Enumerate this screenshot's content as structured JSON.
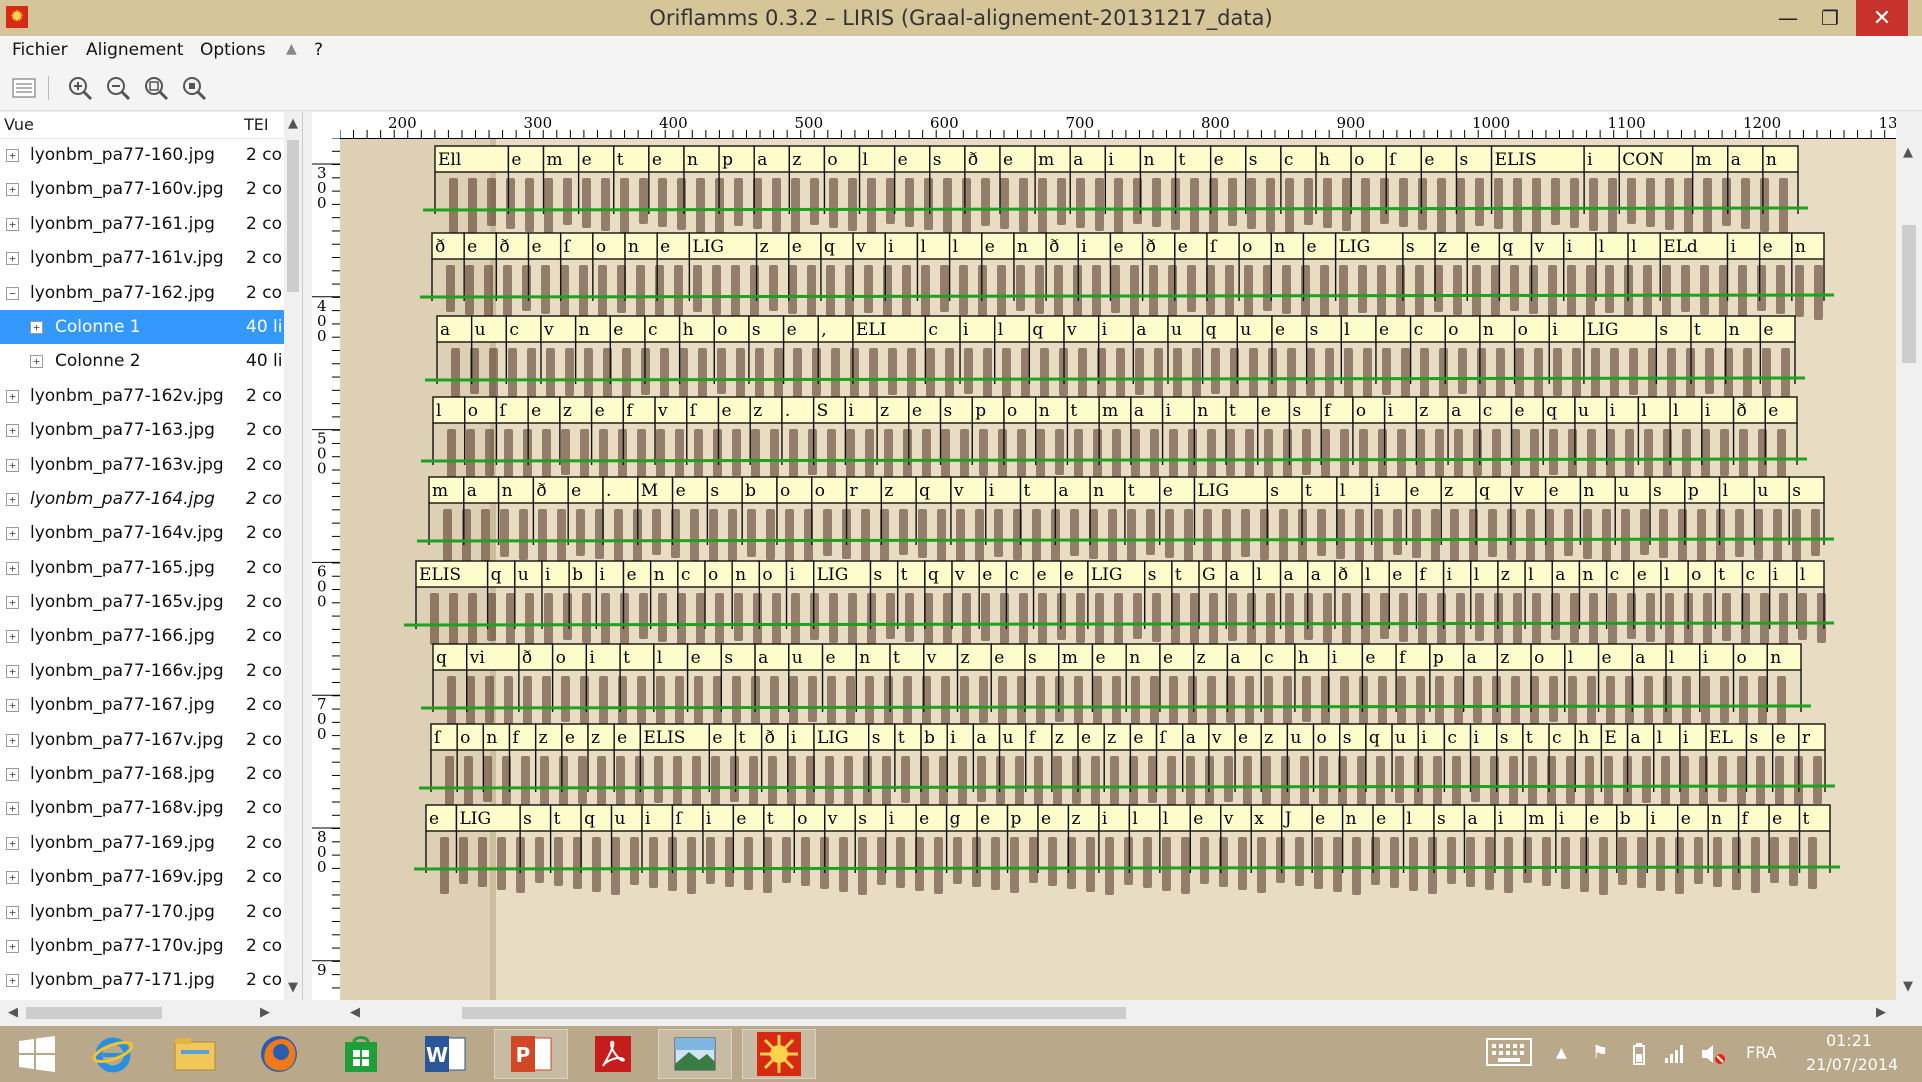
{
  "window": {
    "title": "Oriflamms 0.3.2 – LIRIS (Graal-alignement-20131217_data)",
    "controls": {
      "minimize": "—",
      "maximize": "❐",
      "close": "✕"
    }
  },
  "menu": {
    "items": [
      "Fichier",
      "Alignement",
      "Options",
      "?"
    ]
  },
  "toolbar": {
    "icons": [
      "panel-toggle-icon",
      "zoom-in-icon",
      "zoom-out-icon",
      "zoom-fit-icon",
      "zoom-reset-icon"
    ]
  },
  "tree": {
    "col_vue": "Vue",
    "col_tei": "TEI",
    "rows": [
      {
        "name": "lyonbm_pa77-160.jpg",
        "value": "2 co",
        "level": 0,
        "expander": "+"
      },
      {
        "name": "lyonbm_pa77-160v.jpg",
        "value": "2 co",
        "level": 0,
        "expander": "+"
      },
      {
        "name": "lyonbm_pa77-161.jpg",
        "value": "2 co",
        "level": 0,
        "expander": "+"
      },
      {
        "name": "lyonbm_pa77-161v.jpg",
        "value": "2 co",
        "level": 0,
        "expander": "+"
      },
      {
        "name": "lyonbm_pa77-162.jpg",
        "value": "2 co",
        "level": 0,
        "expander": "−"
      },
      {
        "name": "Colonne 1",
        "value": "40 li",
        "level": 1,
        "expander": "+",
        "selected": true
      },
      {
        "name": "Colonne 2",
        "value": "40 li",
        "level": 1,
        "expander": "+"
      },
      {
        "name": "lyonbm_pa77-162v.jpg",
        "value": "2 co",
        "level": 0,
        "expander": "+"
      },
      {
        "name": "lyonbm_pa77-163.jpg",
        "value": "2 co",
        "level": 0,
        "expander": "+"
      },
      {
        "name": "lyonbm_pa77-163v.jpg",
        "value": "2 co",
        "level": 0,
        "expander": "+"
      },
      {
        "name": "lyonbm_pa77-164.jpg",
        "value": "2 co",
        "level": 0,
        "expander": "+",
        "italic": true
      },
      {
        "name": "lyonbm_pa77-164v.jpg",
        "value": "2 co",
        "level": 0,
        "expander": "+"
      },
      {
        "name": "lyonbm_pa77-165.jpg",
        "value": "2 co",
        "level": 0,
        "expander": "+"
      },
      {
        "name": "lyonbm_pa77-165v.jpg",
        "value": "2 co",
        "level": 0,
        "expander": "+"
      },
      {
        "name": "lyonbm_pa77-166.jpg",
        "value": "2 co",
        "level": 0,
        "expander": "+"
      },
      {
        "name": "lyonbm_pa77-166v.jpg",
        "value": "2 co",
        "level": 0,
        "expander": "+"
      },
      {
        "name": "lyonbm_pa77-167.jpg",
        "value": "2 co",
        "level": 0,
        "expander": "+"
      },
      {
        "name": "lyonbm_pa77-167v.jpg",
        "value": "2 co",
        "level": 0,
        "expander": "+"
      },
      {
        "name": "lyonbm_pa77-168.jpg",
        "value": "2 co",
        "level": 0,
        "expander": "+"
      },
      {
        "name": "lyonbm_pa77-168v.jpg",
        "value": "2 co",
        "level": 0,
        "expander": "+"
      },
      {
        "name": "lyonbm_pa77-169.jpg",
        "value": "2 co",
        "level": 0,
        "expander": "+"
      },
      {
        "name": "lyonbm_pa77-169v.jpg",
        "value": "2 co",
        "level": 0,
        "expander": "+"
      },
      {
        "name": "lyonbm_pa77-170.jpg",
        "value": "2 co",
        "level": 0,
        "expander": "+"
      },
      {
        "name": "lyonbm_pa77-170v.jpg",
        "value": "2 co",
        "level": 0,
        "expander": "+"
      },
      {
        "name": "lyonbm_pa77-171.jpg",
        "value": "2 co",
        "level": 0,
        "expander": "+"
      }
    ]
  },
  "rulers": {
    "top_labels": [
      "200",
      "300",
      "400",
      "500",
      "600",
      "700",
      "800",
      "900",
      "1000",
      "1100",
      "1200",
      "13"
    ],
    "left_labels": [
      "300",
      "400",
      "500",
      "600",
      "700",
      "800",
      "9"
    ]
  },
  "canvas": {
    "lines": [
      "Ell e m e t e n p a z o l e s ð e m a i n t e s c h o ſ e s ELIS i CON m a n",
      "ð e ð e ſ o n e LIG z e q v i l l e n ð i e ð e ſ o n e LIG s z e q v i l l ELd i e n",
      "a u c v n e c h o s e , ELI c i l q v i a u q u e s l e c o n o i LIG s t n e",
      "l o ſ e z e f v ſ e z . S i z e s p o n t m a i n t e s f o i z a c e q u i l l i ð e",
      "m a n ð e . M e s b o o r z q v i t a n t e LIG s t l i e z q v e n u s p l u s",
      "ELIS q u i b i e n c o n o i LIG s t q v e c e e LIG s t G a l a a ð l e f i l z l a n c e l o t c i l",
      "q vi ð o i t l e s a u e n t v z e s m e n e z a c h i e f p a z o l e a l i o n",
      "ſ o n f z e z e ELIS e t ð i LIG s t b i a u f z e z e ſ a v e z u o s q u i c i s t c h E a l i EL s e r",
      "e LIG s t q u i ſ i e t o v s i e g e p e z i l l e v x J e n e l s a i m i e b i e n f e t"
    ]
  },
  "taskbar": {
    "apps": [
      "windows-start-icon",
      "internet-explorer-icon",
      "file-explorer-icon",
      "firefox-icon",
      "store-icon",
      "word-icon",
      "powerpoint-icon",
      "acrobat-icon",
      "photo-viewer-icon",
      "oriflamms-icon"
    ],
    "lang": "FRA",
    "time": "01:21",
    "date": "21/07/2014"
  },
  "colors": {
    "titlebar": "#d7c59a",
    "selection": "#3399ff",
    "box_fill": "#fffccc",
    "baseline": "#1fa01f",
    "parchment": "#e6d6b8"
  }
}
